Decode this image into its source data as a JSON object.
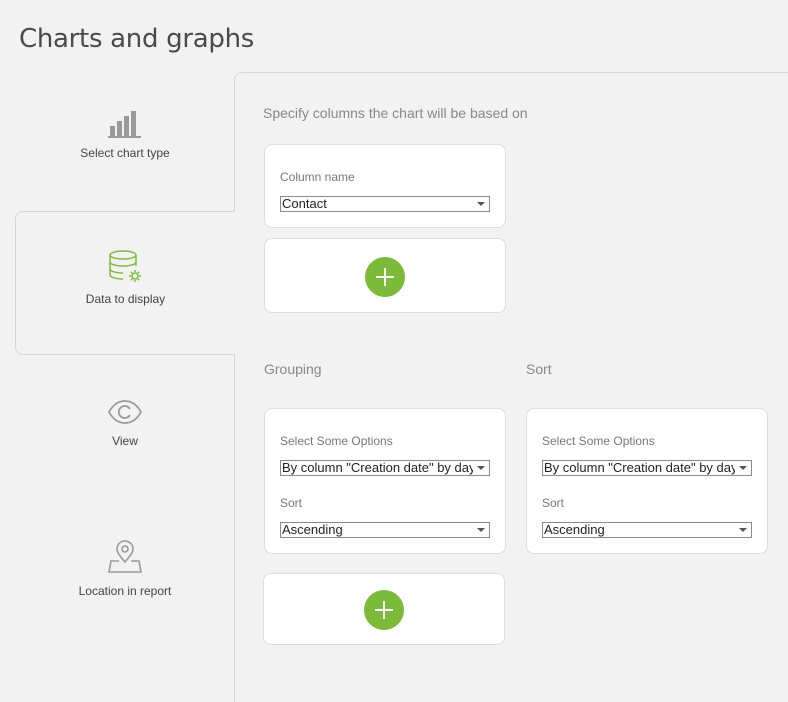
{
  "page": {
    "title": "Charts and graphs"
  },
  "steps": [
    {
      "label": "Select chart type",
      "icon": "bar-chart-icon"
    },
    {
      "label": "Data to display",
      "icon": "database-settings-icon",
      "active": true
    },
    {
      "label": "View",
      "icon": "eye-icon"
    },
    {
      "label": "Location in report",
      "icon": "location-pin-icon"
    }
  ],
  "columns_section": {
    "heading": "Specify columns the chart will be based on",
    "column_name_label": "Column name",
    "column_name_value": "Contact"
  },
  "grouping": {
    "heading": "Grouping",
    "options_label": "Select Some Options",
    "options_value": "By column \"Creation date\" by day",
    "sort_label": "Sort",
    "sort_value": "Ascending"
  },
  "sort": {
    "heading": "Sort",
    "options_label": "Select Some Options",
    "options_value": "By column \"Creation date\" by day",
    "sort_label": "Sort",
    "sort_value": "Ascending"
  },
  "colors": {
    "accent": "#7cbb3a",
    "active_icon": "#7cbb3a"
  }
}
